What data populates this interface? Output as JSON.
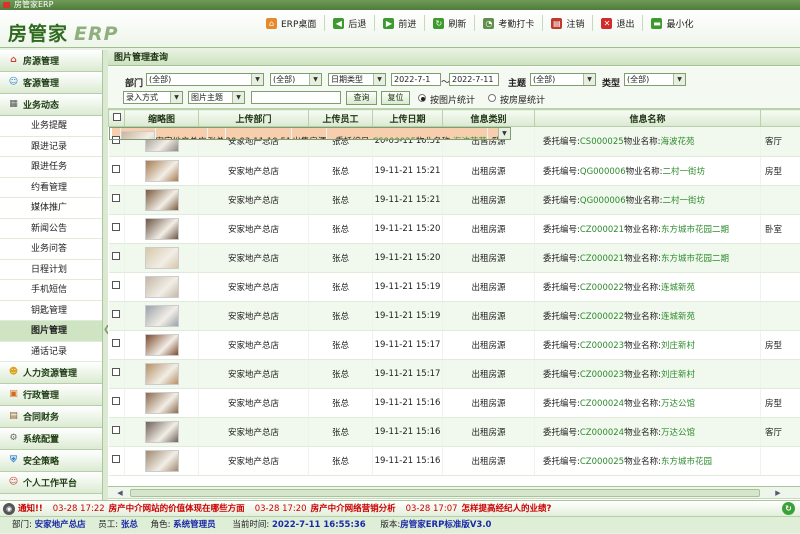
{
  "window": {
    "title": "房管家ERP"
  },
  "brand": {
    "cn": "房管家",
    "en": "ERP"
  },
  "toolbar": [
    {
      "label": "ERP桌面",
      "icon": "home-icon",
      "color": "#e88a2a"
    },
    {
      "label": "后退",
      "icon": "back-arrow-icon",
      "color": "#3d9a2f"
    },
    {
      "label": "前进",
      "icon": "forward-arrow-icon",
      "color": "#3d9a2f"
    },
    {
      "label": "刷新",
      "icon": "refresh-icon",
      "color": "#3d9a2f"
    },
    {
      "label": "考勤打卡",
      "icon": "clock-in-icon",
      "color": "#5f8f4a"
    },
    {
      "label": "注销",
      "icon": "logout-doc-icon",
      "color": "#c0392b"
    },
    {
      "label": "退出",
      "icon": "exit-x-icon",
      "color": "#d22b2b"
    },
    {
      "label": "最小化",
      "icon": "minimize-icon",
      "color": "#3d9a2f"
    }
  ],
  "sidebar": {
    "top": [
      {
        "label": "房源管理",
        "icon": "house-icon"
      },
      {
        "label": "客源管理",
        "icon": "customer-icon"
      },
      {
        "label": "业务动态",
        "icon": "business-icon"
      }
    ],
    "subitems": [
      "业务提醒",
      "跟进记录",
      "跟进任务",
      "约看管理",
      "媒体推广",
      "新闻公告",
      "业务问答",
      "日程计划",
      "手机短信",
      "钥匙管理",
      "图片管理",
      "通话记录"
    ],
    "active_sub": "图片管理",
    "bottom": [
      {
        "label": "人力资源管理",
        "icon": "people-icon"
      },
      {
        "label": "行政管理",
        "icon": "admin-icon"
      },
      {
        "label": "合同财务",
        "icon": "contract-icon"
      },
      {
        "label": "系统配置",
        "icon": "gear-icon"
      },
      {
        "label": "安全策略",
        "icon": "shield-icon"
      },
      {
        "label": "个人工作平台",
        "icon": "user-icon"
      }
    ]
  },
  "panel": {
    "title": "图片管理查询"
  },
  "filters": {
    "dept_label": "部门",
    "dept_value": "(全部)",
    "dept2_value": "(全部)",
    "date_type_value": "日期类型",
    "date_from": "2022-7-1",
    "date_sep": "～",
    "date_to": "2022-7-11",
    "subject_label": "主题",
    "subject_value": "(全部)",
    "type_label": "类型",
    "type_value": "(全部)",
    "entry_mode_value": "录入方式",
    "pic_subject_value": "图片主题",
    "keyword_value": "",
    "query_label": "查询",
    "reset_label": "复位",
    "radio1_label": "按图片统计",
    "radio2_label": "按房屋统计"
  },
  "table": {
    "headers": [
      "",
      "缩略图",
      "上传部门",
      "上传员工",
      "上传日期",
      "信息类别",
      "信息名称",
      ""
    ],
    "rows": [
      {
        "dept": "安家地产总店",
        "staff": "张总",
        "date": "20-03-11 10:51",
        "cat": "出售房源",
        "code": "CS000025",
        "prop": "海波花苑",
        "extra": "卧室",
        "thumb": "#c9b59c"
      },
      {
        "dept": "安家地产总店",
        "staff": "张总",
        "date": "20-03-11 10:51",
        "cat": "出售房源",
        "code": "CS000025",
        "prop": "海波花苑",
        "extra": "客厅",
        "thumb": "#8e8a84"
      },
      {
        "dept": "安家地产总店",
        "staff": "张总",
        "date": "19-11-21 15:21",
        "cat": "出租房源",
        "code": "QG000006",
        "prop": "二村一街坊",
        "extra": "房型",
        "thumb": "#a67c52"
      },
      {
        "dept": "安家地产总店",
        "staff": "张总",
        "date": "19-11-21 15:21",
        "cat": "出租房源",
        "code": "QG000006",
        "prop": "二村一街坊",
        "extra": "",
        "thumb": "#7b5a3d"
      },
      {
        "dept": "安家地产总店",
        "staff": "张总",
        "date": "19-11-21 15:20",
        "cat": "出租房源",
        "code": "CZ000021",
        "prop": "东方城市花园二期",
        "extra": "卧室",
        "thumb": "#6d5443"
      },
      {
        "dept": "安家地产总店",
        "staff": "张总",
        "date": "19-11-21 15:20",
        "cat": "出租房源",
        "code": "CZ000021",
        "prop": "东方城市花园二期",
        "extra": "",
        "thumb": "#d6c7a8"
      },
      {
        "dept": "安家地产总店",
        "staff": "张总",
        "date": "19-11-21 15:19",
        "cat": "出租房源",
        "code": "CZ000022",
        "prop": "连城新苑",
        "extra": "",
        "thumb": "#c4b8a6"
      },
      {
        "dept": "安家地产总店",
        "staff": "张总",
        "date": "19-11-21 15:19",
        "cat": "出租房源",
        "code": "CZ000022",
        "prop": "连城新苑",
        "extra": "",
        "thumb": "#9aa2ab"
      },
      {
        "dept": "安家地产总店",
        "staff": "张总",
        "date": "19-11-21 15:17",
        "cat": "出租房源",
        "code": "CZ000023",
        "prop": "刘庄新村",
        "extra": "房型",
        "thumb": "#7d4b2f"
      },
      {
        "dept": "安家地产总店",
        "staff": "张总",
        "date": "19-11-21 15:17",
        "cat": "出租房源",
        "code": "CZ000023",
        "prop": "刘庄新村",
        "extra": "",
        "thumb": "#b59068"
      },
      {
        "dept": "安家地产总店",
        "staff": "张总",
        "date": "19-11-21 15:16",
        "cat": "出租房源",
        "code": "CZ000024",
        "prop": "万达公馆",
        "extra": "房型",
        "thumb": "#8a6a4b"
      },
      {
        "dept": "安家地产总店",
        "staff": "张总",
        "date": "19-11-21 15:16",
        "cat": "出租房源",
        "code": "CZ000024",
        "prop": "万达公馆",
        "extra": "客厅",
        "thumb": "#6e6158"
      },
      {
        "dept": "安家地产总店",
        "staff": "张总",
        "date": "19-11-21 15:16",
        "cat": "出租房源",
        "code": "CZ000025",
        "prop": "东方城市花园",
        "extra": "",
        "thumb": "#9f8870"
      }
    ],
    "code_prefix": "委托编号:",
    "prop_prefix": "物业名称:",
    "selected_index": 0
  },
  "ticker": {
    "label": "通知!!",
    "items": [
      {
        "time": "03-28 17:22",
        "text": "房产中介网站的价值体现在哪些方面"
      },
      {
        "time": "03-28 17:20",
        "text": "房产中介网络营销分析"
      },
      {
        "time": "03-28 17:07",
        "text": "怎样提高经纪人的业绩?"
      }
    ]
  },
  "status": {
    "dept_label": "部门:",
    "dept_value": "安家地产总店",
    "staff_label": "员工:",
    "staff_value": "张总",
    "role_label": "角色:",
    "role_value": "系统管理员",
    "time_label": "当前时间:",
    "time_value": "2022-7-11 16:55:36",
    "version_label": "版本:",
    "version_value": "房管家ERP标准版V3.0"
  }
}
